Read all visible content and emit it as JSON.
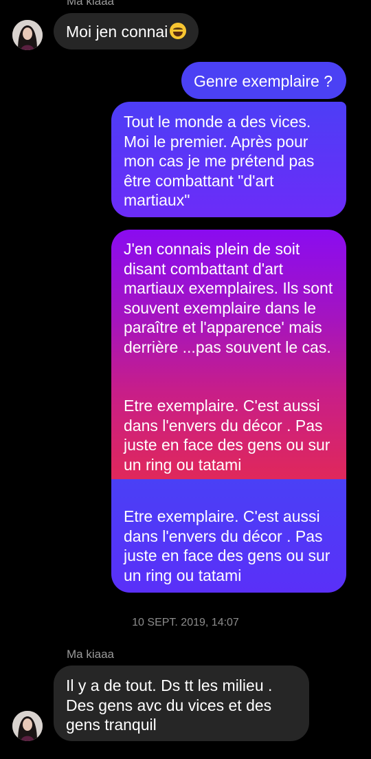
{
  "thread": {
    "top_sender_name": "Ma kiaaa",
    "msg1": "Moi jen connai",
    "msg1_emoji": "laughing-with-tears-emoji",
    "msg2": "Genre exemplaire ?",
    "msg3": "Tout le monde a des vices. Moi le premier. Après pour mon cas je me prétend pas être combattant \"d'art martiaux\"",
    "msg4_para1": "J'en connais plein de soit disant combattant d'art martiaux exemplaires. Ils sont souvent exemplaire dans le paraître et l'apparence' mais derrière ...pas souvent le cas.",
    "msg4_para2": "Etre exemplaire. C'est aussi dans l'envers du décor . Pas juste en face des gens ou sur un ring ou tatami",
    "msg5": "Etre exemplaire. C'est aussi dans l'envers du décor . Pas juste en face des gens ou sur un ring ou tatami",
    "timestamp": "10 SEPT. 2019, 14:07",
    "sender_name": "Ma kiaaa",
    "msg6": "Il y a de tout. Ds tt les milieu . Des gens avc du vices et des gens tranquil"
  },
  "colors": {
    "incoming": "#262626",
    "outgoing_blue": "#4a3cf6",
    "outgoing_purple": "#8a10ee",
    "outgoing_magenta": "#e0285a"
  }
}
